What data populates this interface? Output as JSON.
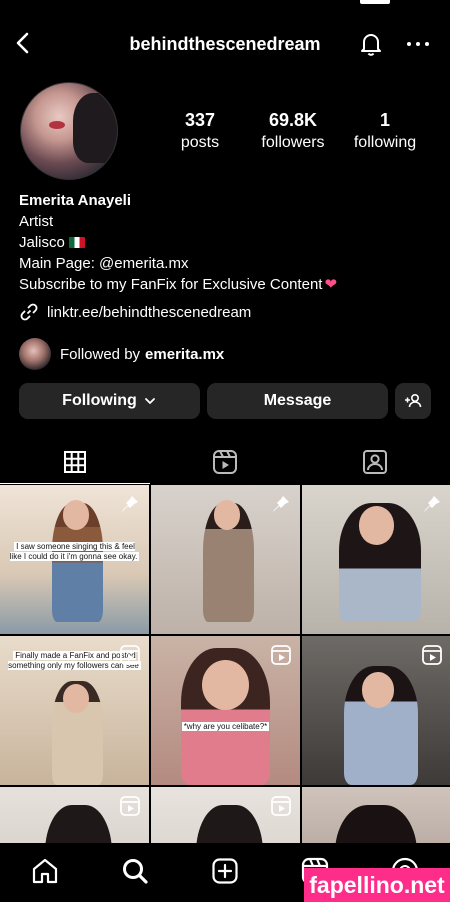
{
  "header": {
    "username": "behindthescenedream"
  },
  "stats": [
    {
      "value": "337",
      "label": "posts"
    },
    {
      "value": "69.8K",
      "label": "followers"
    },
    {
      "value": "1",
      "label": "following"
    }
  ],
  "bio": {
    "name": "Emerita Anayeli",
    "category": "Artist",
    "location": "Jalisco",
    "main_page": "Main Page: @emerita.mx",
    "subscribe": "Subscribe to my FanFix for Exclusive Content",
    "link": "linktr.ee/behindthescenedream"
  },
  "followed_by": {
    "prefix": "Followed by",
    "user": "emerita.mx"
  },
  "buttons": {
    "following": "Following",
    "message": "Message"
  },
  "tabs": [
    "grid-icon",
    "reels-icon",
    "tagged-icon"
  ],
  "grid": {
    "captions": [
      "I saw someone singing this & feel like I could do it i'm gonna see okay.",
      "Finally made a FanFix and posted something only my followers can see",
      "*why are you celibate?*"
    ]
  },
  "bottom_nav": [
    "home-icon",
    "search-icon",
    "create-icon",
    "reels-icon",
    "profile-icon"
  ],
  "watermark": "fapellino.net",
  "colors": {
    "background": "#000000",
    "button": "#262626",
    "watermark": "#ff2d8a"
  }
}
